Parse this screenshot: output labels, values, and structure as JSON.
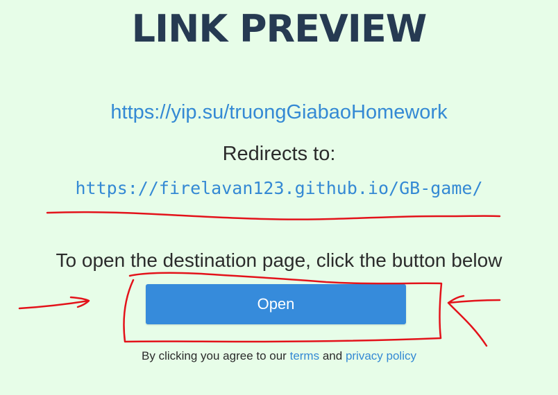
{
  "header": {
    "title": "LINK PREVIEW"
  },
  "link": {
    "short_url": "https://yip.su/truongGiabaoHomework",
    "redirects_label": "Redirects to:",
    "destination_url": "https://firelavan123.github.io/GB-game/"
  },
  "action": {
    "instruction": "To open the destination page, click the button below",
    "open_label": "Open"
  },
  "footer": {
    "agree_prefix": "By clicking you agree to our",
    "terms_label": "terms",
    "and_label": "and",
    "privacy_label": "privacy policy"
  },
  "colors": {
    "background": "#e7fde8",
    "title": "#263a52",
    "link": "#3489d4",
    "button": "#368bdb",
    "annotation": "#e3121a"
  }
}
